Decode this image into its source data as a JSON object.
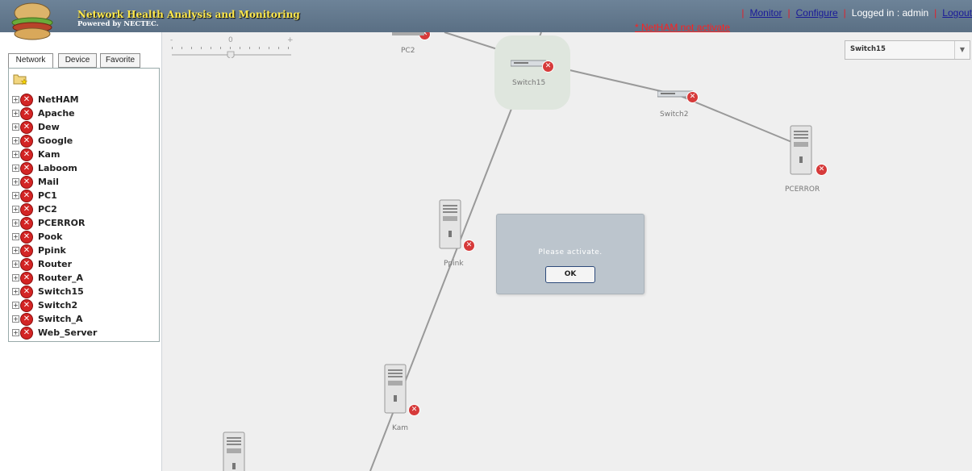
{
  "header": {
    "title": "Network Health Analysis and Monitoring",
    "powered_by": "Powered by NECTEC.",
    "nav": {
      "monitor": "Monitor",
      "configure": "Configure",
      "logged_in": "Logged in : admin",
      "logout": "Logout",
      "separator": "|"
    },
    "warning": "* NetHAM not activate",
    "logo_icon": "hamburger-logo-icon"
  },
  "sidebar": {
    "tabs": [
      {
        "label": "Network",
        "active": true
      },
      {
        "label": "Device",
        "active": false
      },
      {
        "label": "Favorite",
        "active": false
      }
    ],
    "tree_root_icon": "folder-star-icon",
    "tree_items": [
      {
        "label": "NetHAM",
        "status": "error"
      },
      {
        "label": "Apache",
        "status": "error"
      },
      {
        "label": "Dew",
        "status": "error"
      },
      {
        "label": "Google",
        "status": "error"
      },
      {
        "label": "Kam",
        "status": "error"
      },
      {
        "label": "Laboom",
        "status": "error"
      },
      {
        "label": "Mail",
        "status": "error"
      },
      {
        "label": "PC1",
        "status": "error"
      },
      {
        "label": "PC2",
        "status": "error"
      },
      {
        "label": "PCERROR",
        "status": "error"
      },
      {
        "label": "Pook",
        "status": "error"
      },
      {
        "label": "Ppink",
        "status": "error"
      },
      {
        "label": "Router",
        "status": "error"
      },
      {
        "label": "Router_A",
        "status": "error"
      },
      {
        "label": "Switch15",
        "status": "error"
      },
      {
        "label": "Switch2",
        "status": "error"
      },
      {
        "label": "Switch_A",
        "status": "error"
      },
      {
        "label": "Web_Server",
        "status": "error"
      }
    ]
  },
  "map": {
    "zoom": {
      "minus": "-",
      "zero": "0",
      "plus": "+"
    },
    "node_selector": {
      "value": "Switch15"
    },
    "nodes": {
      "pc2": "PC2",
      "switch15": "Switch15",
      "switch2": "Switch2",
      "pcerror": "PCERROR",
      "ppink": "Ppink",
      "kam": "Kam"
    }
  },
  "dialog": {
    "message": "Please activate.",
    "ok_label": "OK"
  },
  "colors": {
    "header_bg": "#5f7488",
    "title": "#ffe84a",
    "error": "#d32424",
    "map_bg": "#efefef"
  }
}
